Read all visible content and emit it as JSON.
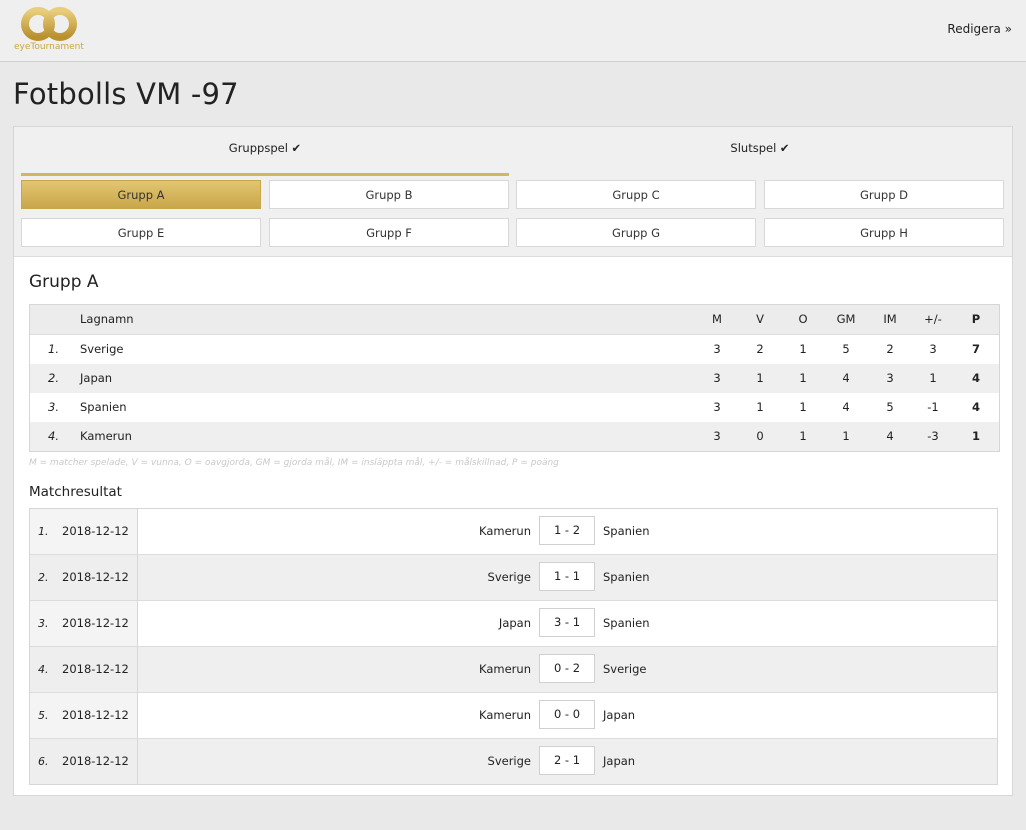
{
  "brand": {
    "name": "eyeTournament",
    "color": "#c9a741",
    "icon": "infinity-logo-icon"
  },
  "header": {
    "edit_label": "Redigera »"
  },
  "page": {
    "title": "Fotbolls VM -97"
  },
  "stages": [
    {
      "label": "Gruppspel ✔",
      "active": true
    },
    {
      "label": "Slutspel ✔",
      "active": false
    }
  ],
  "groups": [
    "Grupp A",
    "Grupp B",
    "Grupp C",
    "Grupp D",
    "Grupp E",
    "Grupp F",
    "Grupp G",
    "Grupp H"
  ],
  "active_group": "Grupp A",
  "group_title": "Grupp A",
  "standings": {
    "columns": {
      "team": "Lagnamn",
      "m": "M",
      "v": "V",
      "o": "O",
      "gm": "GM",
      "im": "IM",
      "diff": "+/-",
      "p": "P"
    },
    "rows": [
      {
        "rank": "1.",
        "team": "Sverige",
        "m": "3",
        "v": "2",
        "o": "1",
        "gm": "5",
        "im": "2",
        "diff": "3",
        "p": "7"
      },
      {
        "rank": "2.",
        "team": "Japan",
        "m": "3",
        "v": "1",
        "o": "1",
        "gm": "4",
        "im": "3",
        "diff": "1",
        "p": "4"
      },
      {
        "rank": "3.",
        "team": "Spanien",
        "m": "3",
        "v": "1",
        "o": "1",
        "gm": "4",
        "im": "5",
        "diff": "-1",
        "p": "4"
      },
      {
        "rank": "4.",
        "team": "Kamerun",
        "m": "3",
        "v": "0",
        "o": "1",
        "gm": "1",
        "im": "4",
        "diff": "-3",
        "p": "1"
      }
    ],
    "legend": "M = matcher spelade, V = vunna, O = oavgjorda, GM = gjorda mål, IM = insläppta mål, +/- = målskillnad, P = poäng"
  },
  "matches": {
    "title": "Matchresultat",
    "rows": [
      {
        "num": "1.",
        "date": "2018-12-12",
        "home": "Kamerun",
        "score": "1 - 2",
        "away": "Spanien"
      },
      {
        "num": "2.",
        "date": "2018-12-12",
        "home": "Sverige",
        "score": "1 - 1",
        "away": "Spanien"
      },
      {
        "num": "3.",
        "date": "2018-12-12",
        "home": "Japan",
        "score": "3 - 1",
        "away": "Spanien"
      },
      {
        "num": "4.",
        "date": "2018-12-12",
        "home": "Kamerun",
        "score": "0 - 2",
        "away": "Sverige"
      },
      {
        "num": "5.",
        "date": "2018-12-12",
        "home": "Kamerun",
        "score": "0 - 0",
        "away": "Japan"
      },
      {
        "num": "6.",
        "date": "2018-12-12",
        "home": "Sverige",
        "score": "2 - 1",
        "away": "Japan"
      }
    ]
  }
}
